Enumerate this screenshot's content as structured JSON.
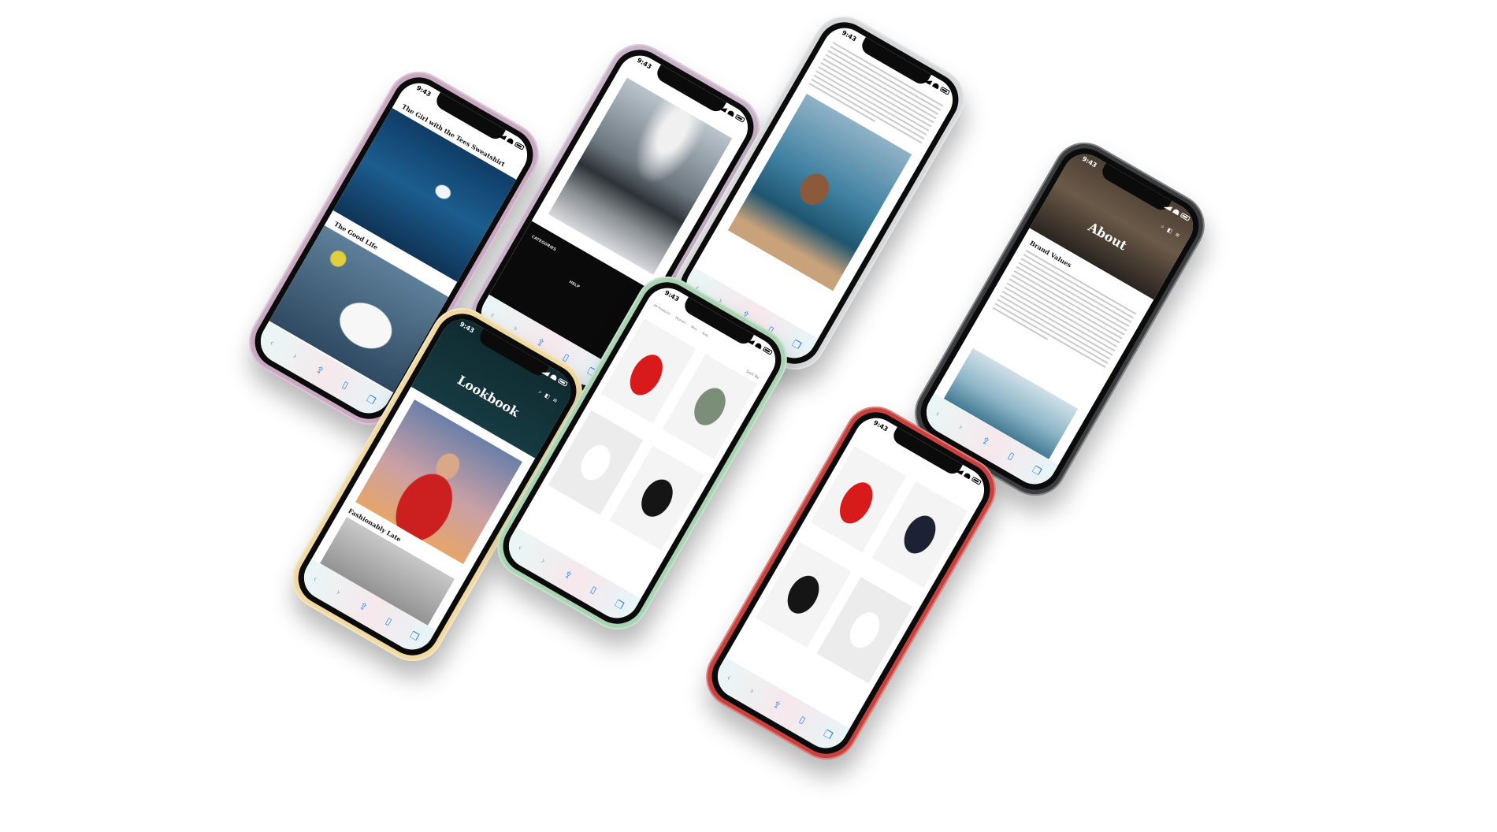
{
  "status_time": "9:43",
  "frame_colors": {
    "lilac": "#c9a9c2",
    "lavender": "#c8b3c9",
    "silver": "#d6d8da",
    "graphite": "#3b3d40",
    "gold": "#f0d9a2",
    "mint": "#a9d3b3",
    "red": "#c8413e"
  },
  "phones": {
    "blog": {
      "post1_title": "The Girl with the Tees Sweatshirt",
      "post2_title": "The Good Life"
    },
    "lighthouse": {
      "footer_categories": "CATEGORIES",
      "footer_help": "HELP"
    },
    "about": {
      "hero_title": "About",
      "section_title": "Brand Values"
    },
    "lookbook": {
      "hero_title": "Lookbook",
      "post_title": "Fashionably Late"
    },
    "shop": {
      "tabs": [
        "All Products",
        "Women",
        "Men",
        "Kids"
      ],
      "sort_label": "Sort By"
    }
  },
  "toolbar_icons": [
    "back-icon",
    "forward-icon",
    "share-icon",
    "bookmarks-icon",
    "tabs-icon"
  ]
}
